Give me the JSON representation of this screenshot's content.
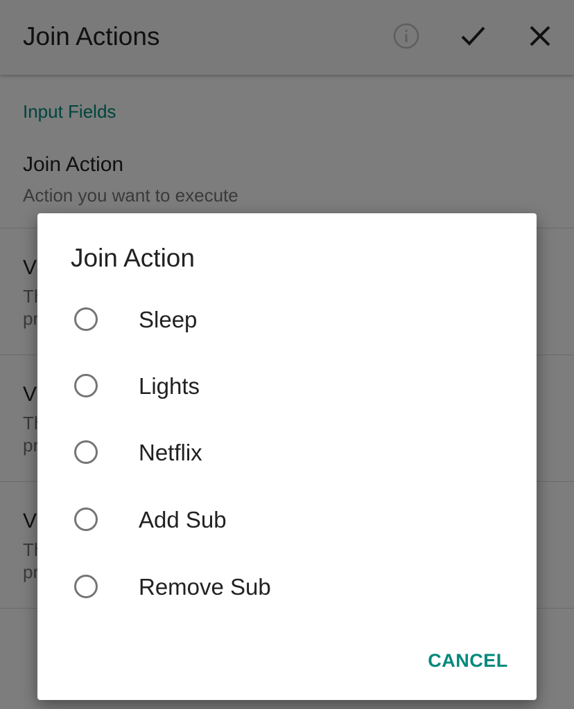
{
  "appbar": {
    "title": "Join Actions",
    "icons": [
      "info-icon",
      "check-icon",
      "close-icon"
    ]
  },
  "content": {
    "section_header": "Input Fields",
    "join_action": {
      "title": "Join Action",
      "summary": "Action you want to execute"
    },
    "partial_items": [
      {
        "title": "V",
        "summary": "Th\npr"
      },
      {
        "title": "V",
        "summary": "Th\npr"
      },
      {
        "title": "V",
        "summary": "Th\npr"
      }
    ]
  },
  "dialog": {
    "title": "Join Action",
    "options": [
      "Sleep",
      "Lights",
      "Netflix",
      "Add Sub",
      "Remove Sub"
    ],
    "cancel_label": "CANCEL"
  },
  "colors": {
    "accent": "#00897b",
    "text_primary": "#212121",
    "text_secondary": "#757575"
  }
}
